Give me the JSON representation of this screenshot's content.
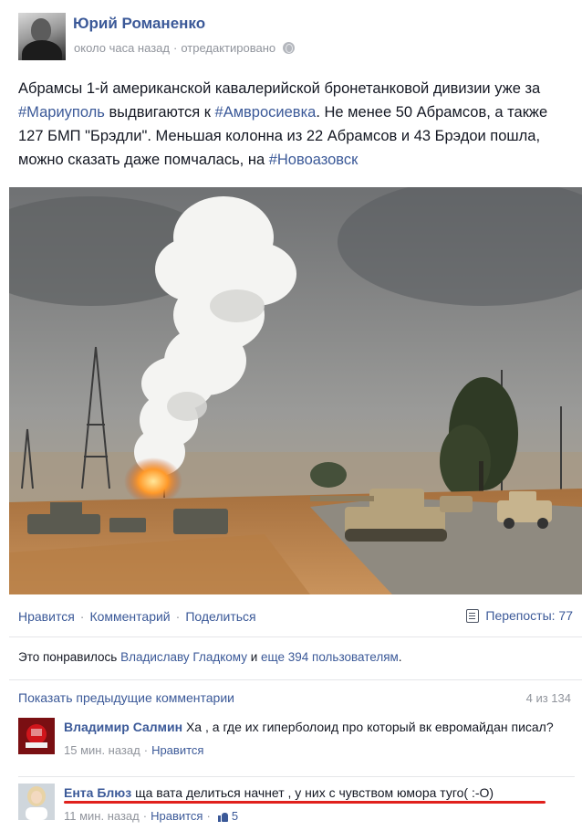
{
  "post": {
    "author": "Юрий Романенко",
    "time": "около часа назад",
    "dot": "·",
    "edited": "отредактировано",
    "text": [
      {
        "t": "Абрамсы 1-й американской кавалерийской бронетанковой дивизии уже за ",
        "tag": false
      },
      {
        "t": "#Мариуполь",
        "tag": true
      },
      {
        "t": " выдвигаются к ",
        "tag": false
      },
      {
        "t": "#Амвросиевка",
        "tag": true
      },
      {
        "t": ". Не менее 50 Абрамсов, а также 127 БМП \"Брэдли\". Меньшая колонна из 22 Абрамсов и 43 Брэдои пошла, можно сказать даже помчалась, на ",
        "tag": false
      },
      {
        "t": "#Новоазовск",
        "tag": true
      }
    ]
  },
  "actions": {
    "like": "Нравится",
    "comment": "Комментарий",
    "share": "Поделиться",
    "sep": "·",
    "reposts": "Перепосты: 77"
  },
  "likes": {
    "prefix": "Это понравилось ",
    "who": "Владиславу Гладкому",
    "middle": " и ",
    "others": "еще 394 пользователям",
    "suffix": "."
  },
  "comments_header": {
    "show_previous": "Показать предыдущие комментарии",
    "count": "4 из 134"
  },
  "comments": [
    {
      "name": "Владимир Салмин",
      "text": "Ха , а где их гиперболоид про который вк евромайдан писал?",
      "time": "15 мин. назад",
      "like": "Нравится",
      "likes_count": ""
    },
    {
      "name": "Ента Блюз",
      "text": "ща вата делиться начнет , у них с чувством юмора туго( :-О)",
      "time": "11 мин. назад",
      "like": "Нравится",
      "likes_count": "5"
    }
  ],
  "colors": {
    "link": "#3b5998",
    "muted": "#90949c",
    "underline": "#e0201c"
  },
  "icons": {
    "privacy": "globe-icon",
    "reposts": "repost-icon",
    "like_count": "thumbs-up-icon"
  }
}
